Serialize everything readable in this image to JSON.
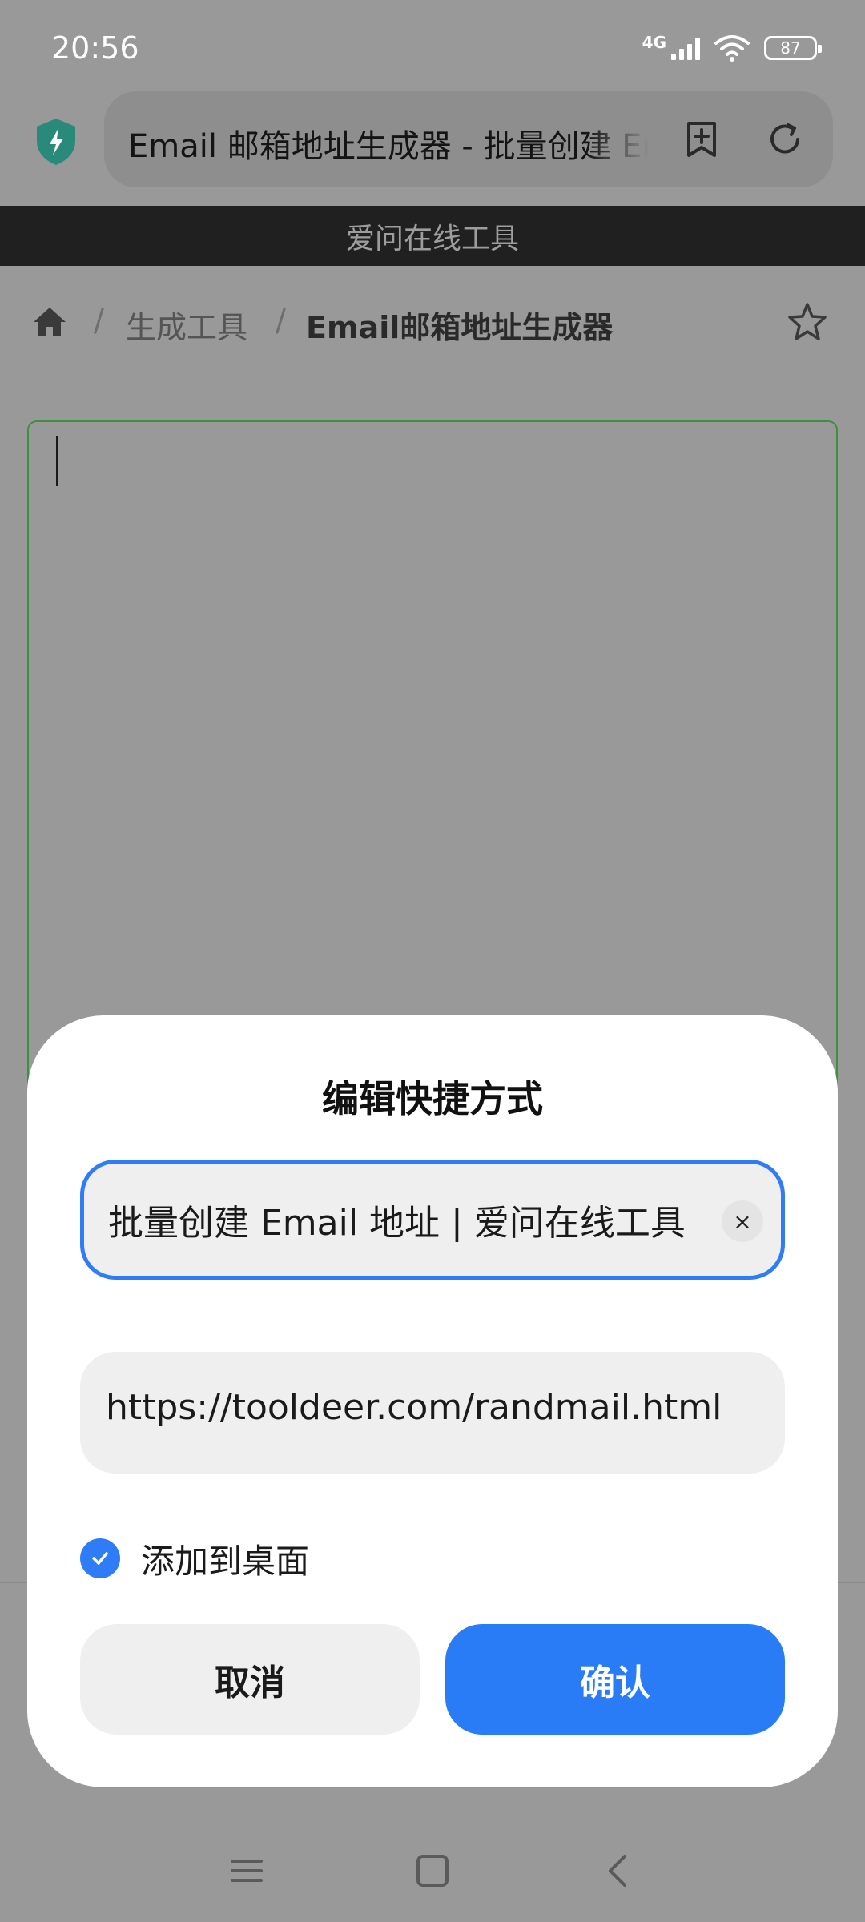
{
  "status_bar": {
    "time": "20:56",
    "network": "4G",
    "battery": "87"
  },
  "browser": {
    "url_title": "Email 邮箱地址生成器 - 批量创建 Email 地址",
    "icons": {
      "security": "shield-bolt-icon",
      "add_bookmark": "bookmark-add-icon",
      "reload": "reload-icon"
    }
  },
  "site": {
    "banner": "爱问在线工具",
    "breadcrumb": {
      "sep": "/",
      "generator": "生成工具",
      "current": "Email邮箱地址生成器"
    }
  },
  "dialog": {
    "title": "编辑快捷方式",
    "name_value": "批量创建 Email 地址 | 爱问在线工具",
    "clear_symbol": "×",
    "url_value": "https://tooldeer.com/randmail.html",
    "checkbox_label": "添加到桌面",
    "checkbox_checked": true,
    "cancel_label": "取消",
    "confirm_label": "确认",
    "accent_color": "#2e7cf6"
  }
}
